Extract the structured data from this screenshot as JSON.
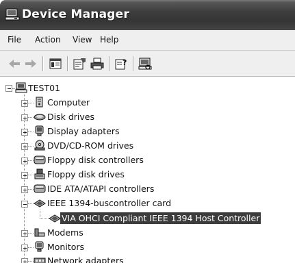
{
  "window": {
    "title": "Device Manager",
    "title_icon": "device-manager-icon"
  },
  "menu": {
    "items": [
      "File",
      "Action",
      "View",
      "Help"
    ]
  },
  "toolbar": {
    "buttons": [
      "back-arrow-icon",
      "forward-arrow-icon",
      "show-hide-console-tree-icon",
      "properties-icon",
      "print-icon",
      "help-icon",
      "scan-hardware-icon"
    ]
  },
  "tree": {
    "root": {
      "label": "TEST01",
      "icon": "computer-icon",
      "expanded": true
    },
    "items": [
      {
        "label": "Computer",
        "icon": "computer-icon",
        "expanded": false
      },
      {
        "label": "Disk drives",
        "icon": "disk-drive-icon",
        "expanded": false
      },
      {
        "label": "Display adapters",
        "icon": "display-adapter-icon",
        "expanded": false
      },
      {
        "label": "DVD/CD-ROM drives",
        "icon": "cdrom-icon",
        "expanded": false
      },
      {
        "label": "Floppy disk controllers",
        "icon": "controller-icon",
        "expanded": false
      },
      {
        "label": "Floppy disk drives",
        "icon": "floppy-drive-icon",
        "expanded": false
      },
      {
        "label": "IDE ATA/ATAPI controllers",
        "icon": "controller-icon",
        "expanded": false
      },
      {
        "label": "IEEE 1394-buscontroller card",
        "icon": "card-icon",
        "expanded": true,
        "children": [
          {
            "label": "VIA OHCI Compliant IEEE 1394 Host Controller",
            "icon": "card-icon",
            "selected": true
          }
        ]
      },
      {
        "label": "Modems",
        "icon": "modem-icon",
        "expanded": false
      },
      {
        "label": "Monitors",
        "icon": "monitor-icon",
        "expanded": false
      },
      {
        "label": "Network adapters",
        "icon": "network-adapter-icon",
        "expanded": false
      }
    ]
  }
}
